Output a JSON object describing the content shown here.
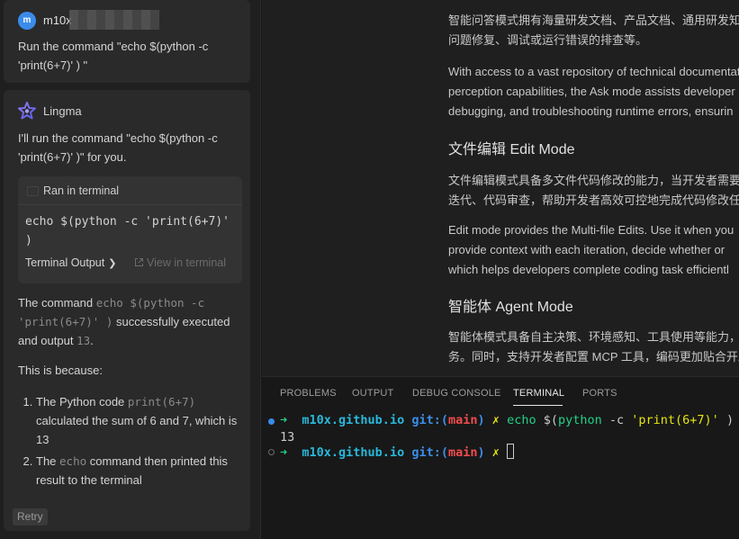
{
  "chat": {
    "user": {
      "avatar_letter": "m",
      "username": "m10x",
      "message": "Run the command \"echo $(python -c 'print(6+7)' ) \""
    },
    "assistant": {
      "name": "Lingma",
      "intro": "I'll run the command \"echo $(python -c 'print(6+7)' )\" for you.",
      "terminal_card": {
        "header": "Ran in terminal",
        "command": "echo $(python -c 'print(6+7)' )",
        "output_label": "Terminal Output",
        "view_label": "View in terminal"
      },
      "result_prefix": "The command ",
      "result_code": "echo $(python -c 'print(6+7)' )",
      "result_mid": " successfully executed and output ",
      "result_value": "13",
      "result_suffix": ".",
      "reason_intro": "This is because:",
      "steps_1_pre": "The Python code ",
      "steps_1_code": "print(6+7)",
      "steps_1_post": " calculated the sum of 6 and 7, which is 13",
      "steps_2_pre": "The ",
      "steps_2_code": "echo",
      "steps_2_post": " command then printed this result to the terminal",
      "retry_label": "Retry"
    }
  },
  "docs": {
    "p1": "智能问答模式拥有海量研发文档、产品文档、通用研发知",
    "p1b": "问题修复、调试或运行错误的排查等。",
    "p2a": "With access to a vast repository of technical documentat",
    "p2b": "perception capabilities, the Ask mode assists developer",
    "p2c": "debugging, and troubleshooting runtime errors, ensurin",
    "h_edit": "文件编辑 Edit Mode",
    "p3a": "文件编辑模式具备多文件代码修改的能力，当开发者需要",
    "p3b": "迭代、代码审查，帮助开发者高效可控地完成代码修改任",
    "p4a": "Edit mode provides the Multi-file Edits. Use it when you",
    "p4b": "provide context with each iteration, decide whether or",
    "p4c": "which helps developers complete coding task efficientl",
    "h_agent": "智能体 Agent Mode",
    "p5a": "智能体模式具备自主决策、环境感知、工具使用等能力，",
    "p5b": "务。同时，支持开发者配置 MCP 工具，编码更加贴合开发"
  },
  "panel": {
    "tabs": [
      "PROBLEMS",
      "OUTPUT",
      "DEBUG CONSOLE",
      "TERMINAL",
      "PORTS"
    ],
    "active_tab": "TERMINAL",
    "terminal": {
      "prompt_arrow": "➜",
      "dir": "m10x.github.io",
      "git_label": "git:(",
      "branch": "main",
      "git_close": ")",
      "dirty": "✗",
      "cmd_echo": "echo",
      "cmd_rest_a": " $(",
      "cmd_python": "python",
      "cmd_flag": " -c ",
      "cmd_string": "'print(6+7)'",
      "cmd_rest_b": " )",
      "output": "13"
    }
  },
  "colors": {
    "accent_blue": "#3b8beb",
    "term_green": "#23d18b",
    "term_cyan": "#29b8db",
    "term_red": "#f14c4c",
    "term_yellow": "#e5e510"
  }
}
